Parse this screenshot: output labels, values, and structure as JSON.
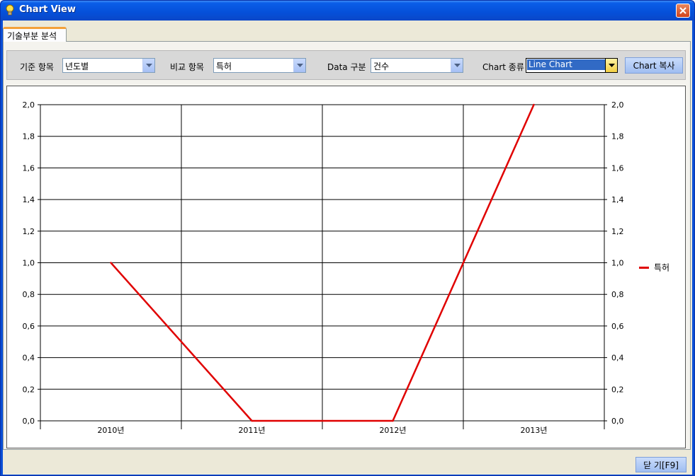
{
  "window": {
    "title": "Chart View"
  },
  "tabs": [
    {
      "label": "기술부분 분석",
      "active": true
    }
  ],
  "toolbar": {
    "base_label": "기준 항목",
    "base_value": "년도별",
    "compare_label": "비교 항목",
    "compare_value": "특허",
    "data_label": "Data 구분",
    "data_value": "건수",
    "chart_type_label": "Chart 종류",
    "chart_type_value": "Line Chart",
    "copy_button": "Chart 복사"
  },
  "footer": {
    "close_button": "닫 기[F9]"
  },
  "colors": {
    "series": "#e00000",
    "title_bar": "#0550d9",
    "client_bg": "#ece9d8"
  },
  "chart_data": {
    "type": "line",
    "categories": [
      "2010년",
      "2011년",
      "2012년",
      "2013년"
    ],
    "series": [
      {
        "name": "특허",
        "values": [
          1,
          0,
          0,
          2
        ]
      }
    ],
    "y_ticks": [
      "0,0",
      "0,2",
      "0,4",
      "0,6",
      "0,8",
      "1,0",
      "1,2",
      "1,4",
      "1,6",
      "1,8",
      "2,0"
    ],
    "ylim": [
      0,
      2
    ],
    "secondary_y_axis": true,
    "grid": true,
    "legend_position": "right"
  }
}
